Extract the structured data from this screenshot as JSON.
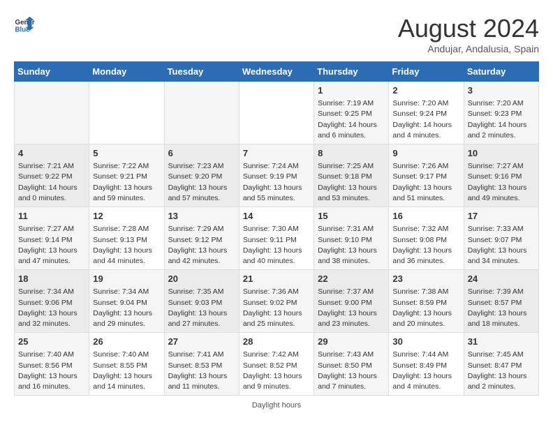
{
  "header": {
    "logo_line1": "General",
    "logo_line2": "Blue",
    "title": "August 2024",
    "subtitle": "Andujar, Andalusia, Spain"
  },
  "footer": {
    "text": "Daylight hours"
  },
  "days_of_week": [
    "Sunday",
    "Monday",
    "Tuesday",
    "Wednesday",
    "Thursday",
    "Friday",
    "Saturday"
  ],
  "weeks": [
    {
      "days": [
        {
          "num": "",
          "info": ""
        },
        {
          "num": "",
          "info": ""
        },
        {
          "num": "",
          "info": ""
        },
        {
          "num": "",
          "info": ""
        },
        {
          "num": "1",
          "info": "Sunrise: 7:19 AM\nSunset: 9:25 PM\nDaylight: 14 hours\nand 6 minutes."
        },
        {
          "num": "2",
          "info": "Sunrise: 7:20 AM\nSunset: 9:24 PM\nDaylight: 14 hours\nand 4 minutes."
        },
        {
          "num": "3",
          "info": "Sunrise: 7:20 AM\nSunset: 9:23 PM\nDaylight: 14 hours\nand 2 minutes."
        }
      ]
    },
    {
      "days": [
        {
          "num": "4",
          "info": "Sunrise: 7:21 AM\nSunset: 9:22 PM\nDaylight: 14 hours\nand 0 minutes."
        },
        {
          "num": "5",
          "info": "Sunrise: 7:22 AM\nSunset: 9:21 PM\nDaylight: 13 hours\nand 59 minutes."
        },
        {
          "num": "6",
          "info": "Sunrise: 7:23 AM\nSunset: 9:20 PM\nDaylight: 13 hours\nand 57 minutes."
        },
        {
          "num": "7",
          "info": "Sunrise: 7:24 AM\nSunset: 9:19 PM\nDaylight: 13 hours\nand 55 minutes."
        },
        {
          "num": "8",
          "info": "Sunrise: 7:25 AM\nSunset: 9:18 PM\nDaylight: 13 hours\nand 53 minutes."
        },
        {
          "num": "9",
          "info": "Sunrise: 7:26 AM\nSunset: 9:17 PM\nDaylight: 13 hours\nand 51 minutes."
        },
        {
          "num": "10",
          "info": "Sunrise: 7:27 AM\nSunset: 9:16 PM\nDaylight: 13 hours\nand 49 minutes."
        }
      ]
    },
    {
      "days": [
        {
          "num": "11",
          "info": "Sunrise: 7:27 AM\nSunset: 9:14 PM\nDaylight: 13 hours\nand 47 minutes."
        },
        {
          "num": "12",
          "info": "Sunrise: 7:28 AM\nSunset: 9:13 PM\nDaylight: 13 hours\nand 44 minutes."
        },
        {
          "num": "13",
          "info": "Sunrise: 7:29 AM\nSunset: 9:12 PM\nDaylight: 13 hours\nand 42 minutes."
        },
        {
          "num": "14",
          "info": "Sunrise: 7:30 AM\nSunset: 9:11 PM\nDaylight: 13 hours\nand 40 minutes."
        },
        {
          "num": "15",
          "info": "Sunrise: 7:31 AM\nSunset: 9:10 PM\nDaylight: 13 hours\nand 38 minutes."
        },
        {
          "num": "16",
          "info": "Sunrise: 7:32 AM\nSunset: 9:08 PM\nDaylight: 13 hours\nand 36 minutes."
        },
        {
          "num": "17",
          "info": "Sunrise: 7:33 AM\nSunset: 9:07 PM\nDaylight: 13 hours\nand 34 minutes."
        }
      ]
    },
    {
      "days": [
        {
          "num": "18",
          "info": "Sunrise: 7:34 AM\nSunset: 9:06 PM\nDaylight: 13 hours\nand 32 minutes."
        },
        {
          "num": "19",
          "info": "Sunrise: 7:34 AM\nSunset: 9:04 PM\nDaylight: 13 hours\nand 29 minutes."
        },
        {
          "num": "20",
          "info": "Sunrise: 7:35 AM\nSunset: 9:03 PM\nDaylight: 13 hours\nand 27 minutes."
        },
        {
          "num": "21",
          "info": "Sunrise: 7:36 AM\nSunset: 9:02 PM\nDaylight: 13 hours\nand 25 minutes."
        },
        {
          "num": "22",
          "info": "Sunrise: 7:37 AM\nSunset: 9:00 PM\nDaylight: 13 hours\nand 23 minutes."
        },
        {
          "num": "23",
          "info": "Sunrise: 7:38 AM\nSunset: 8:59 PM\nDaylight: 13 hours\nand 20 minutes."
        },
        {
          "num": "24",
          "info": "Sunrise: 7:39 AM\nSunset: 8:57 PM\nDaylight: 13 hours\nand 18 minutes."
        }
      ]
    },
    {
      "days": [
        {
          "num": "25",
          "info": "Sunrise: 7:40 AM\nSunset: 8:56 PM\nDaylight: 13 hours\nand 16 minutes."
        },
        {
          "num": "26",
          "info": "Sunrise: 7:40 AM\nSunset: 8:55 PM\nDaylight: 13 hours\nand 14 minutes."
        },
        {
          "num": "27",
          "info": "Sunrise: 7:41 AM\nSunset: 8:53 PM\nDaylight: 13 hours\nand 11 minutes."
        },
        {
          "num": "28",
          "info": "Sunrise: 7:42 AM\nSunset: 8:52 PM\nDaylight: 13 hours\nand 9 minutes."
        },
        {
          "num": "29",
          "info": "Sunrise: 7:43 AM\nSunset: 8:50 PM\nDaylight: 13 hours\nand 7 minutes."
        },
        {
          "num": "30",
          "info": "Sunrise: 7:44 AM\nSunset: 8:49 PM\nDaylight: 13 hours\nand 4 minutes."
        },
        {
          "num": "31",
          "info": "Sunrise: 7:45 AM\nSunset: 8:47 PM\nDaylight: 13 hours\nand 2 minutes."
        }
      ]
    }
  ]
}
